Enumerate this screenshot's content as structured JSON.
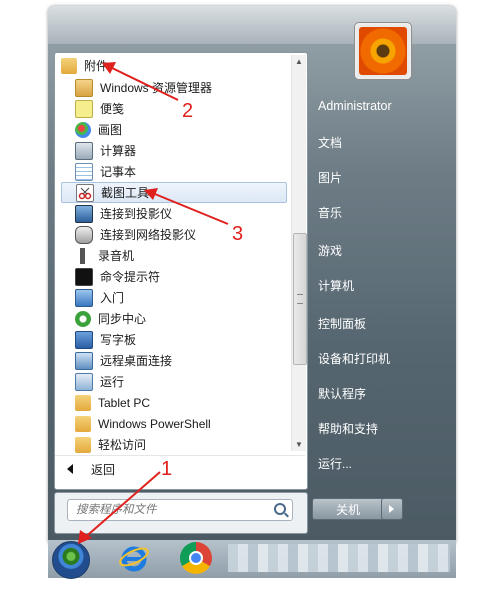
{
  "left_programs": [
    {
      "label": "附件",
      "icon": "folder-icon"
    },
    {
      "label": "Windows 资源管理器",
      "icon": "explorer-icon"
    },
    {
      "label": "便笺",
      "icon": "sticky-notes-icon"
    },
    {
      "label": "画图",
      "icon": "paint-icon"
    },
    {
      "label": "计算器",
      "icon": "calculator-icon"
    },
    {
      "label": "记事本",
      "icon": "notepad-icon"
    },
    {
      "label": "截图工具",
      "icon": "snipping-tool-icon"
    },
    {
      "label": "连接到投影仪",
      "icon": "projector-icon"
    },
    {
      "label": "连接到网络投影仪",
      "icon": "network-projector-icon"
    },
    {
      "label": "录音机",
      "icon": "microphone-icon"
    },
    {
      "label": "命令提示符",
      "icon": "cmd-icon"
    },
    {
      "label": "入门",
      "icon": "getting-started-icon"
    },
    {
      "label": "同步中心",
      "icon": "sync-icon"
    },
    {
      "label": "写字板",
      "icon": "wordpad-icon"
    },
    {
      "label": "远程桌面连接",
      "icon": "remote-desktop-icon"
    },
    {
      "label": "运行",
      "icon": "run-icon"
    },
    {
      "label": "Tablet PC",
      "icon": "folder-icon"
    },
    {
      "label": "Windows PowerShell",
      "icon": "folder-icon"
    },
    {
      "label": "轻松访问",
      "icon": "folder-icon"
    }
  ],
  "back_label": "返回",
  "search": {
    "placeholder": "搜索程序和文件"
  },
  "right_items": [
    "Administrator",
    "文档",
    "图片",
    "音乐",
    "游戏",
    "计算机",
    "控制面板",
    "设备和打印机",
    "默认程序",
    "帮助和支持",
    "运行..."
  ],
  "shutdown_label": "关机",
  "annotations": [
    "1",
    "2",
    "3"
  ],
  "colors": {
    "annotation_red": "#e0201c",
    "menu_highlight_border": "#a8c4e2"
  }
}
